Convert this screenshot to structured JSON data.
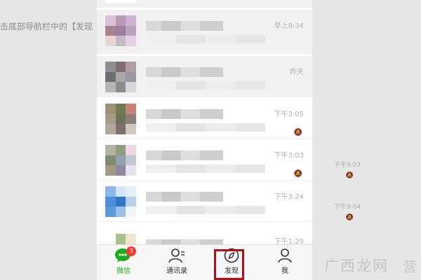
{
  "background": {
    "caption": "击底部导航栏中的【发现",
    "ghost_rows": [
      {
        "time": "下午3:03"
      },
      {
        "time": "下午3:04"
      }
    ]
  },
  "chat_list": {
    "rows": [
      {
        "time": "",
        "muted": false,
        "highlight": "gray",
        "avatar": [
          "#3eb34a",
          "#3eb34a",
          "#3eb34a",
          "#ffffff",
          "#ffffff",
          "#ffffff",
          "#ffffff",
          "#ffffff",
          "#ffffff"
        ]
      },
      {
        "time": "早上9:34",
        "muted": false,
        "highlight": "gray",
        "avatar": [
          "#d8c3d6",
          "#b99bb8",
          "#cdb3d1",
          "#a7828f",
          "#9d7f9b",
          "#b8a2bd",
          "#e7d7d0",
          "#c7b8c5",
          "#e2cfe3"
        ]
      },
      {
        "time": "昨天",
        "muted": false,
        "highlight": "gray",
        "avatar": [
          "#8f8f8f",
          "#7f6e73",
          "#b39da1",
          "#6b6e73",
          "#a7a8a8",
          "#9a9aa2",
          "#b7b5b4",
          "#8c8b8d",
          "#d8d6d6"
        ]
      },
      {
        "time": "下午3:05",
        "muted": true,
        "highlight": "white",
        "avatar": [
          "#9f9078",
          "#6e7a4f",
          "#c88277",
          "#a59c86",
          "#6d7259",
          "#8d7f77",
          "#b1a79a",
          "#7e6f6d",
          "#d2c6c2"
        ]
      },
      {
        "time": "下午3:03",
        "muted": true,
        "highlight": "white",
        "avatar": [
          "#b6b3a4",
          "#8e9f7f",
          "#f0d7df",
          "#7d8a74",
          "#93a1ad",
          "#c2c6d0",
          "#a29b82",
          "#8e8aa3",
          "#e9e2ef"
        ]
      },
      {
        "time": "下午3:24",
        "muted": false,
        "highlight": "white",
        "avatar": [
          "#8db6e8",
          "#d3e4f7",
          "#e6eef8",
          "#4c8fd8",
          "#2f78cc",
          "#b7d0ee",
          "#5d9ad9",
          "#9ac0ea",
          "#f2f5f9"
        ]
      },
      {
        "time": "下午1:29",
        "muted": false,
        "highlight": "white",
        "avatar": [
          "#ffffff",
          "#a9c28c",
          "#f3e4cf",
          "#e9d8a2",
          "#cfe2b4",
          "#ffffff",
          "#f6e8b0",
          "#efe3c3",
          "#ffffff"
        ]
      }
    ]
  },
  "tabbar": {
    "tabs": [
      {
        "label": "微信",
        "icon": "chat-bubble-icon",
        "active": true,
        "badge": "3"
      },
      {
        "label": "通讯录",
        "icon": "contacts-icon",
        "active": false
      },
      {
        "label": "发现",
        "icon": "compass-icon",
        "active": false
      },
      {
        "label": "我",
        "icon": "person-icon",
        "active": false
      }
    ]
  },
  "watermark": {
    "text": "广西龙网",
    "tail_char": "营",
    "accent_color": "#b10e18",
    "brand_green": "#1aad19"
  }
}
